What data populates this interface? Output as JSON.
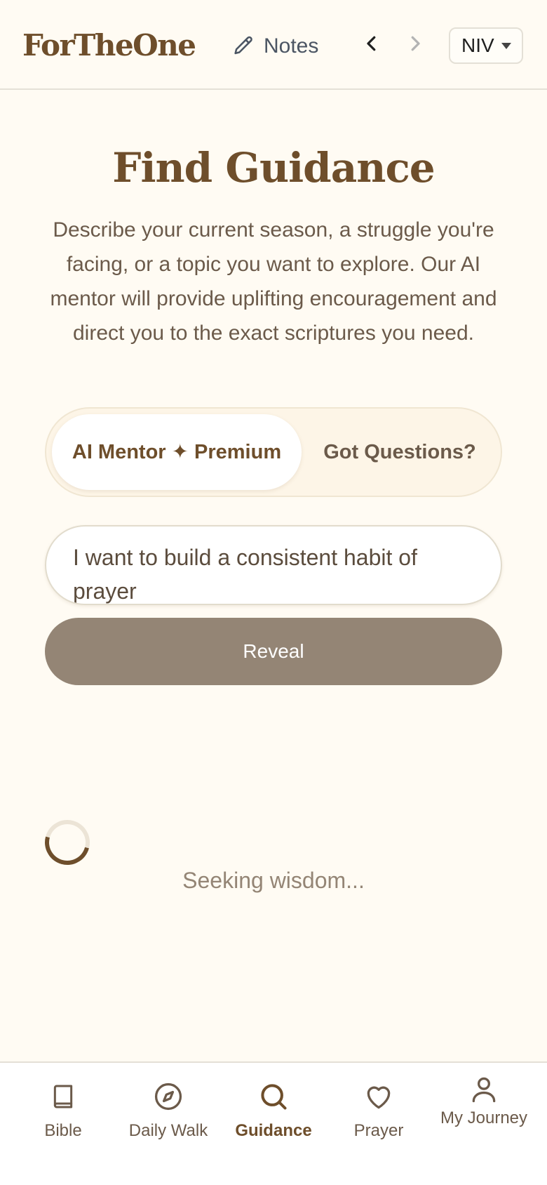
{
  "header": {
    "logo": "ForTheOne",
    "notes_label": "Notes",
    "version": "NIV"
  },
  "main": {
    "title": "Find Guidance",
    "description": "Describe your current season, a struggle you're facing, or a topic you want to explore. Our AI mentor will provide uplifting encouragement and direct you to the exact scriptures you need.",
    "toggle": {
      "active_label": "AI Mentor ✦ Premium",
      "inactive_label": "Got Questions?"
    },
    "prompt_value": "I want to build a consistent habit of prayer",
    "reveal_label": "Reveal",
    "loading_text": "Seeking wisdom..."
  },
  "bottom_nav": {
    "items": [
      {
        "label": "Bible",
        "icon": "book-icon"
      },
      {
        "label": "Daily Walk",
        "icon": "compass-icon"
      },
      {
        "label": "Guidance",
        "icon": "search-icon",
        "active": true
      },
      {
        "label": "Prayer",
        "icon": "heart-icon"
      },
      {
        "label": "My Journey",
        "icon": "user-icon"
      }
    ]
  },
  "colors": {
    "background": "#fffbf3",
    "brand": "#6e4e2b",
    "button": "#948575",
    "muted_text": "#6b5a4a"
  }
}
